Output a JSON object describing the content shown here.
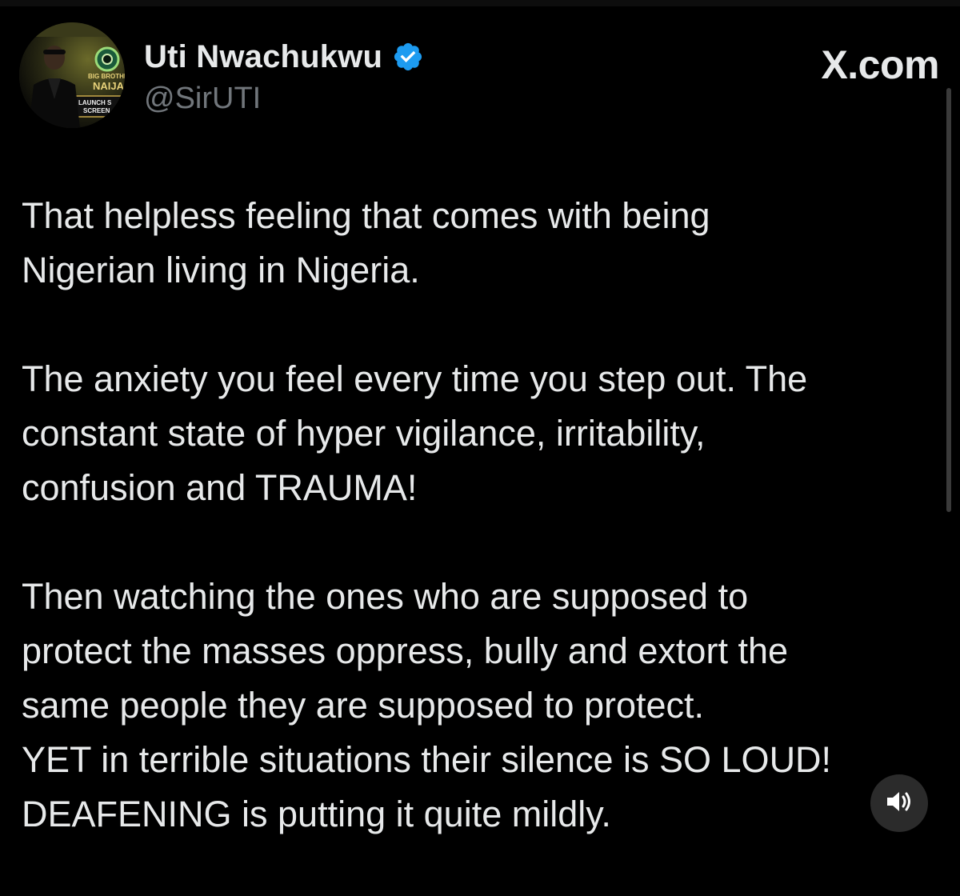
{
  "author": {
    "display_name": "Uti Nwachukwu",
    "handle": "@SirUTI",
    "verified": true,
    "avatar_text": {
      "show_line1": "BIG BROTHER",
      "show_line2": "NAIJA",
      "banner_line1": "LAUNCH S",
      "banner_line2": "SCREEN"
    }
  },
  "site": {
    "wordmark": "X.com"
  },
  "tweet": {
    "paragraphs": [
      {
        "lines": [
          "That helpless feeling that comes with being",
          "Nigerian living in Nigeria."
        ]
      },
      {
        "lines": [
          "The anxiety you feel every time you step out. The",
          "constant state of hyper vigilance, irritability,",
          "confusion and TRAUMA!"
        ]
      },
      {
        "lines": [
          "Then watching the ones who are supposed to",
          "protect the masses oppress, bully and extort the",
          "same people they are supposed to protect.",
          "YET in terrible situations their silence is SO LOUD!",
          "DEAFENING is putting it quite mildly."
        ]
      }
    ]
  },
  "controls": {
    "sound_icon": "speaker-sound-icon"
  },
  "colors": {
    "background": "#000000",
    "text_primary": "#e7e9ea",
    "text_secondary": "#71767b",
    "verified_badge": "#1d9bf0",
    "sound_button_bg": "#2b2b2b"
  }
}
